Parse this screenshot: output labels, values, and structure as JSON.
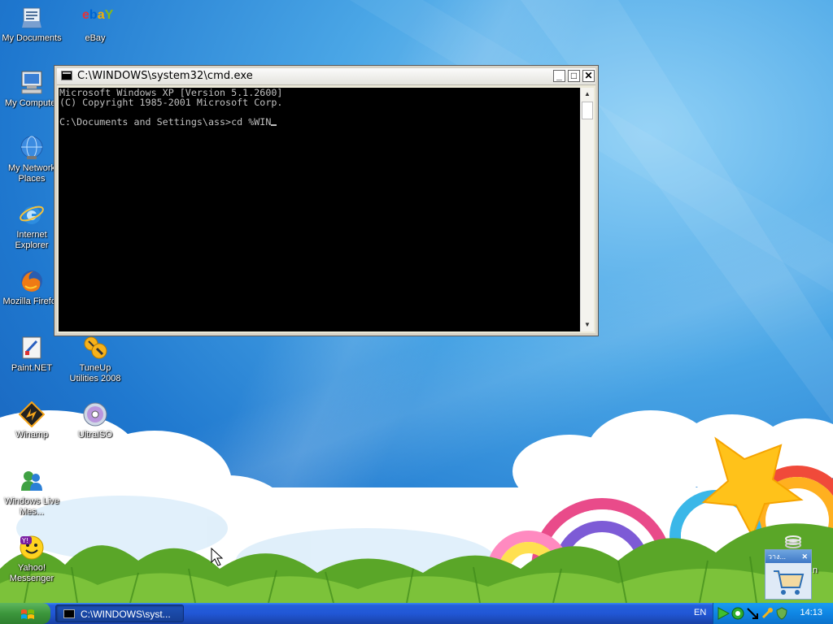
{
  "desktop": {
    "icons": [
      {
        "label": "My Documents",
        "icon": "my-documents-icon"
      },
      {
        "label": "eBay",
        "icon": "ebay-icon"
      },
      {
        "label": "My Computer",
        "icon": "my-computer-icon"
      },
      {
        "label": "My Network Places",
        "icon": "network-places-icon"
      },
      {
        "label": "Internet Explorer",
        "icon": "internet-explorer-icon"
      },
      {
        "label": "Mozilla Firefox",
        "icon": "firefox-icon"
      },
      {
        "label": "Paint.NET",
        "icon": "paint-net-icon"
      },
      {
        "label": "TuneUp Utilities 2008",
        "icon": "tuneup-icon"
      },
      {
        "label": "Winamp",
        "icon": "winamp-icon"
      },
      {
        "label": "UltraISO",
        "icon": "ultraiso-icon"
      },
      {
        "label": "Windows Live Mes...",
        "icon": "windows-live-messenger-icon"
      },
      {
        "label": "Yahoo! Messenger",
        "icon": "yahoo-messenger-icon"
      }
    ],
    "ebay_logo": {
      "e": "e",
      "b": "b",
      "a": "a",
      "y": "Y"
    }
  },
  "cmd_window": {
    "title": "C:\\WINDOWS\\system32\\cmd.exe",
    "buttons": {
      "minimize": "_",
      "maximize": "□",
      "close": "✕"
    },
    "lines": [
      "Microsoft Windows XP [Version 5.1.2600]",
      "(C) Copyright 1985-2001 Microsoft Corp.",
      "",
      "C:\\Documents and Settings\\ass>cd %WIN"
    ]
  },
  "taskbar": {
    "task_label": "C:\\WINDOWS\\syst...",
    "language": "EN",
    "clock": "14:13"
  },
  "widget": {
    "title": "วาง...",
    "close": "✕",
    "side_text": "n"
  },
  "colors": {
    "console_bg": "#000000",
    "console_text": "#c0c0c0",
    "taskbar_blue": "#245edb",
    "start_green": "#3c963c"
  }
}
